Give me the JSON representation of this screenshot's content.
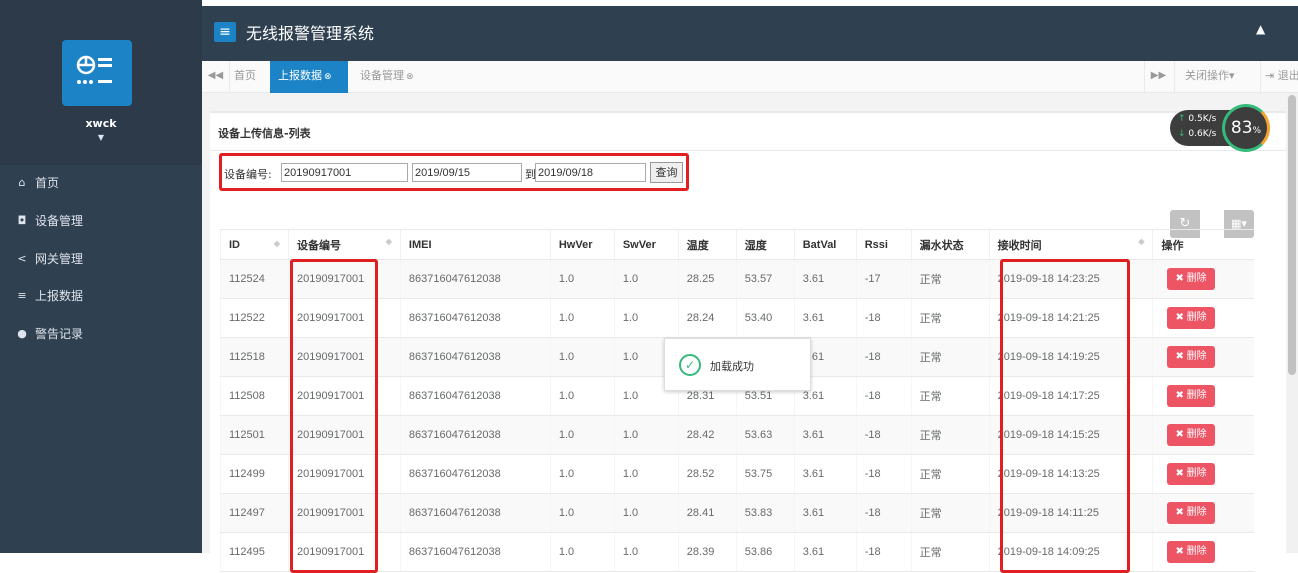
{
  "app": {
    "title": "无线报警管理系统",
    "user": "xwck"
  },
  "sidebar": {
    "items": [
      {
        "label": "首页",
        "icon": "home-icon",
        "glyph": "⌂"
      },
      {
        "label": "设备管理",
        "icon": "device-icon",
        "glyph": "◘"
      },
      {
        "label": "网关管理",
        "icon": "share-icon",
        "glyph": "<"
      },
      {
        "label": "上报数据",
        "icon": "database-icon",
        "glyph": "≡"
      },
      {
        "label": "警告记录",
        "icon": "info-icon",
        "glyph": "●"
      }
    ]
  },
  "tabs": [
    {
      "label": "首页"
    },
    {
      "label": "上报数据",
      "active": true
    },
    {
      "label": "设备管理"
    }
  ],
  "tab_actions": {
    "close_ops": "关闭操作▾",
    "logout": "退出"
  },
  "panel": {
    "title": "设备上传信息-列表"
  },
  "search": {
    "device_label": "设备编号:",
    "device_value": "20190917001",
    "date_from": "2019/09/15",
    "to_label": "到",
    "date_to": "2019/09/18",
    "query_label": "查询"
  },
  "table": {
    "columns": [
      "ID",
      "设备编号",
      "IMEI",
      "HwVer",
      "SwVer",
      "温度",
      "湿度",
      "BatVal",
      "Rssi",
      "漏水状态",
      "接收时间",
      "操作"
    ],
    "rows": [
      [
        "112524",
        "20190917001",
        "863716047612038",
        "1.0",
        "1.0",
        "28.25",
        "53.57",
        "3.61",
        "-17",
        "正常",
        "2019-09-18 14:23:25"
      ],
      [
        "112522",
        "20190917001",
        "863716047612038",
        "1.0",
        "1.0",
        "28.24",
        "53.40",
        "3.61",
        "-18",
        "正常",
        "2019-09-18 14:21:25"
      ],
      [
        "112518",
        "20190917001",
        "863716047612038",
        "1.0",
        "1.0",
        "",
        "",
        "3.61",
        "-18",
        "正常",
        "2019-09-18 14:19:25"
      ],
      [
        "112508",
        "20190917001",
        "863716047612038",
        "1.0",
        "1.0",
        "28.31",
        "53.51",
        "3.61",
        "-18",
        "正常",
        "2019-09-18 14:17:25"
      ],
      [
        "112501",
        "20190917001",
        "863716047612038",
        "1.0",
        "1.0",
        "28.42",
        "53.63",
        "3.61",
        "-18",
        "正常",
        "2019-09-18 14:15:25"
      ],
      [
        "112499",
        "20190917001",
        "863716047612038",
        "1.0",
        "1.0",
        "28.52",
        "53.75",
        "3.61",
        "-18",
        "正常",
        "2019-09-18 14:13:25"
      ],
      [
        "112497",
        "20190917001",
        "863716047612038",
        "1.0",
        "1.0",
        "28.41",
        "53.83",
        "3.61",
        "-18",
        "正常",
        "2019-09-18 14:11:25"
      ],
      [
        "112495",
        "20190917001",
        "863716047612038",
        "1.0",
        "1.0",
        "28.39",
        "53.86",
        "3.61",
        "-18",
        "正常",
        "2019-09-18 14:09:25"
      ]
    ],
    "delete_label": "删除"
  },
  "toast": {
    "message": "加载成功"
  },
  "speed": {
    "up": "0.5",
    "down": "0.6",
    "unit": "K/s",
    "percent": "83",
    "pct_sign": "%"
  },
  "colors": {
    "sidebar": "#2f4050",
    "accent": "#1c84c6",
    "danger": "#ed5565",
    "success": "#35ba7c",
    "highlight": "#e02020"
  }
}
